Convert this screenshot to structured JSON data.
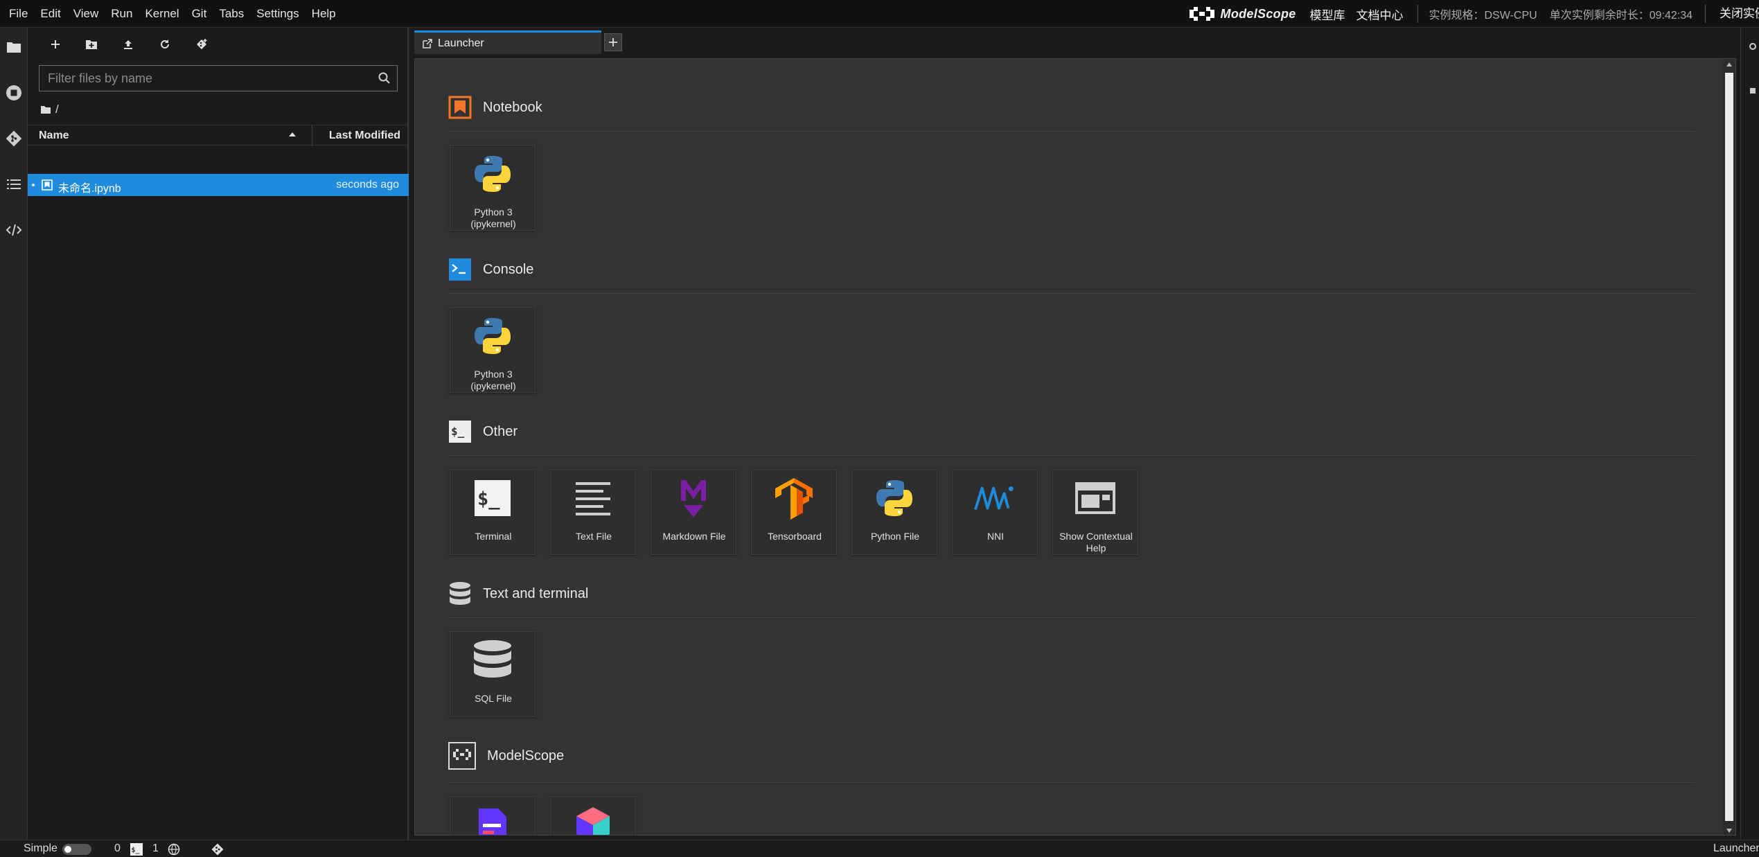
{
  "menubar": {
    "items": [
      "File",
      "Edit",
      "View",
      "Run",
      "Kernel",
      "Git",
      "Tabs",
      "Settings",
      "Help"
    ],
    "brand": "ModelScope",
    "links": [
      "模型库",
      "文档中心"
    ],
    "instance_spec": "实例规格：DSW-CPU",
    "remaining_time": "单次实例剩余时长：09:42:34",
    "close_instance": "关闭实例"
  },
  "filebrowser": {
    "filter_placeholder": "Filter files by name",
    "breadcrumb": "/",
    "columns": {
      "name": "Name",
      "modified": "Last Modified"
    },
    "files": [
      {
        "name": "未命名.ipynb",
        "modified": "seconds ago"
      }
    ]
  },
  "tabs": [
    {
      "label": "Launcher"
    }
  ],
  "launcher": {
    "sections": {
      "notebook": {
        "title": "Notebook",
        "cards": [
          "Python 3\n(ipykernel)"
        ]
      },
      "console": {
        "title": "Console",
        "cards": [
          "Python 3\n(ipykernel)"
        ]
      },
      "other": {
        "title": "Other",
        "cards": [
          "Terminal",
          "Text File",
          "Markdown File",
          "Tensorboard",
          "Python File",
          "NNI",
          "Show Contextual\nHelp"
        ]
      },
      "text_terminal": {
        "title": "Text and terminal",
        "cards": [
          "SQL File"
        ]
      },
      "modelscope": {
        "title": "ModelScope"
      }
    }
  },
  "statusbar": {
    "mode": "Simple",
    "terminals": "0",
    "kernels": "1",
    "current": "Launcher"
  },
  "colors": {
    "accent": "#1f8bdd",
    "notebook_orange": "#f37726",
    "console_blue": "#1f8bdd",
    "markdown_purple": "#7b1fa2",
    "tensorboard_orange": "#ff6f00"
  }
}
